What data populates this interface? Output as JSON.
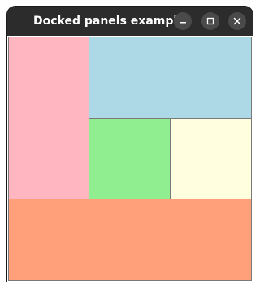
{
  "window": {
    "title": "Docked panels example",
    "controls": {
      "minimize_icon": "minimize-icon",
      "maximize_icon": "maximize-icon",
      "close_icon": "close-icon"
    }
  },
  "panels": [
    {
      "name": "left-panel",
      "color": "#ffb6c1"
    },
    {
      "name": "top-panel",
      "color": "#add8e6"
    },
    {
      "name": "center-panel",
      "color": "#90ee90"
    },
    {
      "name": "right-panel",
      "color": "#ffffe0"
    },
    {
      "name": "bottom-panel",
      "color": "#ffa07a"
    }
  ]
}
